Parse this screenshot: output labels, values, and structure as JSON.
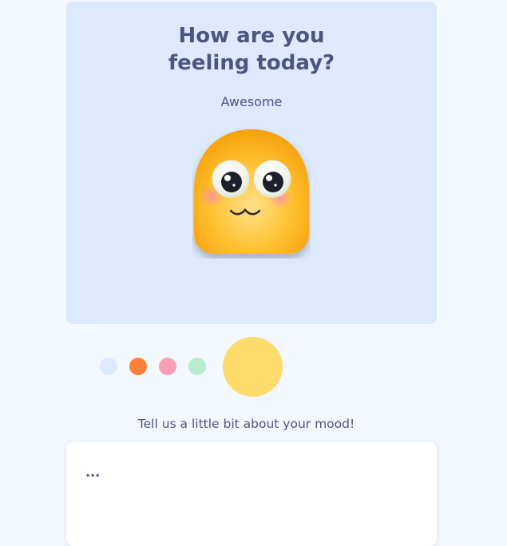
{
  "header": {
    "title_line1": "How are you",
    "title_line2": "feeling today?"
  },
  "current_mood": {
    "label": "Awesome",
    "icon": "happy-blob-emoji-icon"
  },
  "mood_options": [
    {
      "color": "#dde9fd"
    },
    {
      "color": "#fb8139"
    },
    {
      "color": "#f8a0b3"
    },
    {
      "color": "#b8ecd0"
    },
    {
      "color": "#fddc6c",
      "selected": true
    }
  ],
  "journal": {
    "prompt": "Tell us a little bit about your mood!",
    "placeholder": "..."
  },
  "colors": {
    "background": "#f3f7fe",
    "hero": "#dde9fd",
    "text": "#4a5680",
    "accent": "#fddc6c"
  }
}
